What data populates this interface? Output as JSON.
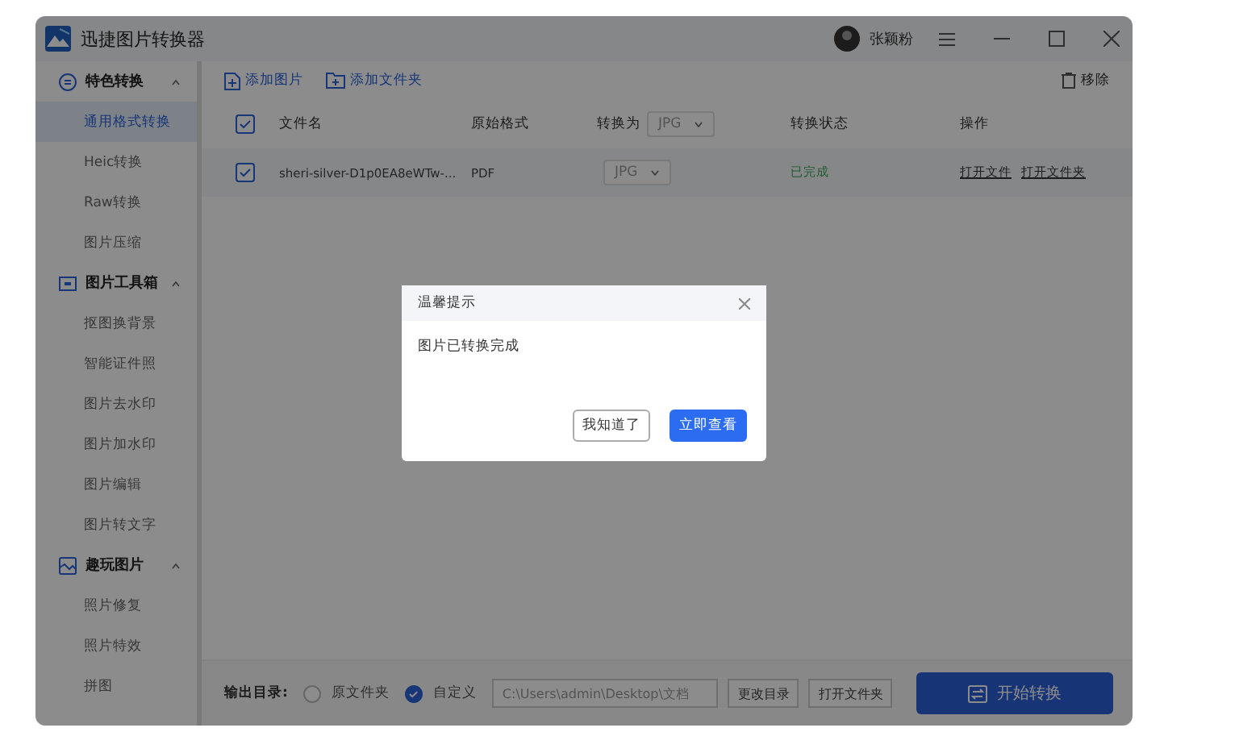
{
  "window": {
    "title": "迅捷图片转换器",
    "user": "张颖粉"
  },
  "sidebar": {
    "groups": [
      {
        "label": "特色转换",
        "expanded": true,
        "items": [
          {
            "label": "通用格式转换",
            "selected": true
          },
          {
            "label": "Heic转换",
            "selected": false
          },
          {
            "label": "Raw转换",
            "selected": false
          },
          {
            "label": "图片压缩",
            "selected": false
          }
        ]
      },
      {
        "label": "图片工具箱",
        "expanded": true,
        "items": [
          {
            "label": "抠图换背景",
            "selected": false
          },
          {
            "label": "智能证件照",
            "selected": false
          },
          {
            "label": "图片去水印",
            "selected": false
          },
          {
            "label": "图片加水印",
            "selected": false
          },
          {
            "label": "图片编辑",
            "selected": false
          },
          {
            "label": "图片转文字",
            "selected": false
          }
        ]
      },
      {
        "label": "趣玩图片",
        "expanded": true,
        "items": [
          {
            "label": "照片修复",
            "selected": false
          },
          {
            "label": "照片特效",
            "selected": false
          },
          {
            "label": "拼图",
            "selected": false
          }
        ]
      }
    ]
  },
  "toolbar": {
    "add_image": "添加图片",
    "add_folder": "添加文件夹",
    "remove": "移除"
  },
  "table": {
    "all_checked": true,
    "columns": [
      "文件名",
      "原始格式",
      "转换为",
      "转换状态",
      "操作"
    ],
    "header_format": "JPG",
    "rows": [
      {
        "checked": true,
        "name": "sheri-silver-D1p0EA8eWTw-...",
        "format": "PDF",
        "target": "JPG",
        "status": "已完成",
        "actions": [
          "打开文件",
          "打开文件夹"
        ]
      }
    ]
  },
  "output": {
    "label": "输出目录:",
    "options": [
      {
        "label": "原文件夹",
        "selected": false
      },
      {
        "label": "自定义",
        "selected": true
      }
    ],
    "path": "C:\\Users\\admin\\Desktop\\文档",
    "change": "更改目录",
    "open": "打开文件夹",
    "start": "开始转换"
  },
  "dialog": {
    "title": "温馨提示",
    "message": "图片已转换完成",
    "buttons": [
      {
        "label": "我知道了",
        "kind": "secondary"
      },
      {
        "label": "立即查看",
        "kind": "primary"
      }
    ]
  }
}
